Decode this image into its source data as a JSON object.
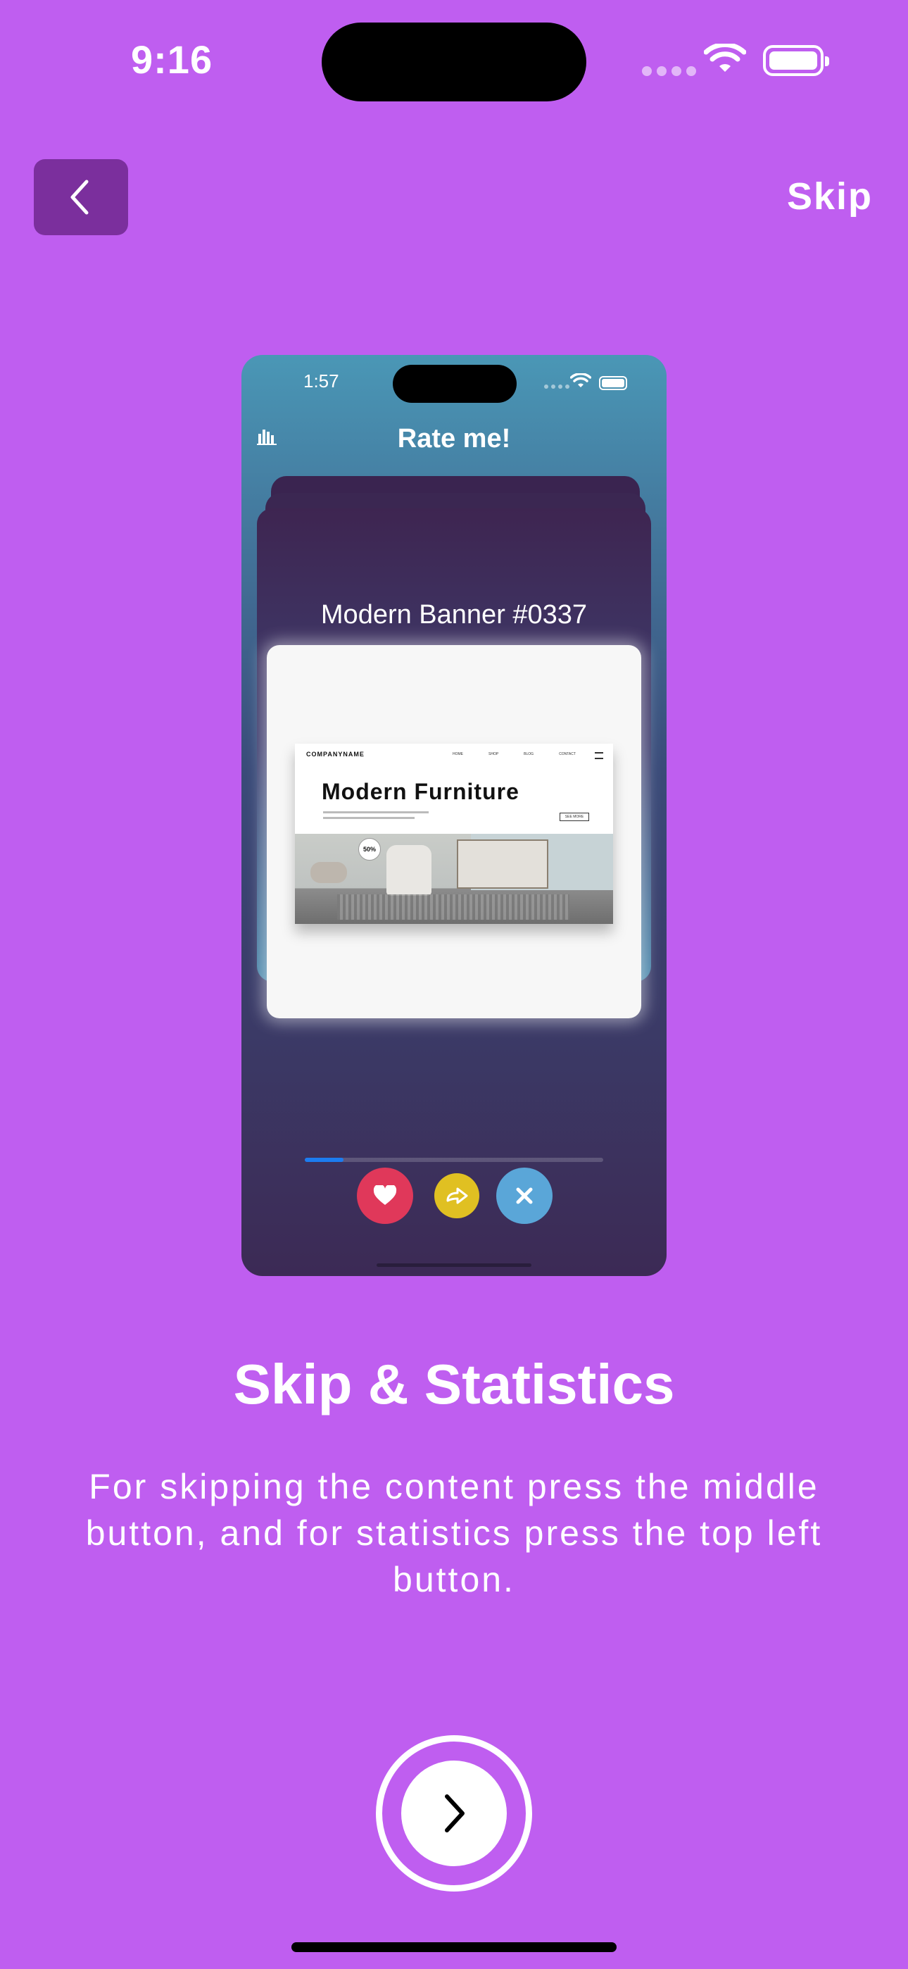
{
  "status_bar": {
    "time": "9:16"
  },
  "nav": {
    "back_icon": "chevron-left-icon",
    "skip_label": "Skip"
  },
  "preview": {
    "time": "1:57",
    "title": "Rate me!",
    "stats_icon": "bar-chart-icon",
    "card_title": "Modern Banner #0337",
    "banner": {
      "company": "COMPANYNAME",
      "nav_items": [
        "HOME",
        "SHOP",
        "BLOG",
        "CONTACT"
      ],
      "heading": "Modern  Furniture",
      "button": "SEE MORE",
      "badge": "50%"
    },
    "progress": 0.13,
    "actions": [
      {
        "name": "like",
        "icon": "heart-icon",
        "color": "#e0385a"
      },
      {
        "name": "skip",
        "icon": "forward-arrow-icon",
        "color": "#e0c022"
      },
      {
        "name": "dislike",
        "icon": "close-icon",
        "color": "#5aa6d8"
      }
    ]
  },
  "onboarding": {
    "title": "Skip & Statistics",
    "description": "For skipping the content press the middle button, and for statistics press the top left button."
  },
  "next_button": {
    "icon": "chevron-right-icon"
  },
  "colors": {
    "background": "#bf5ef0",
    "back_button": "#7b2f9d",
    "progress": "#1c7cf0"
  }
}
